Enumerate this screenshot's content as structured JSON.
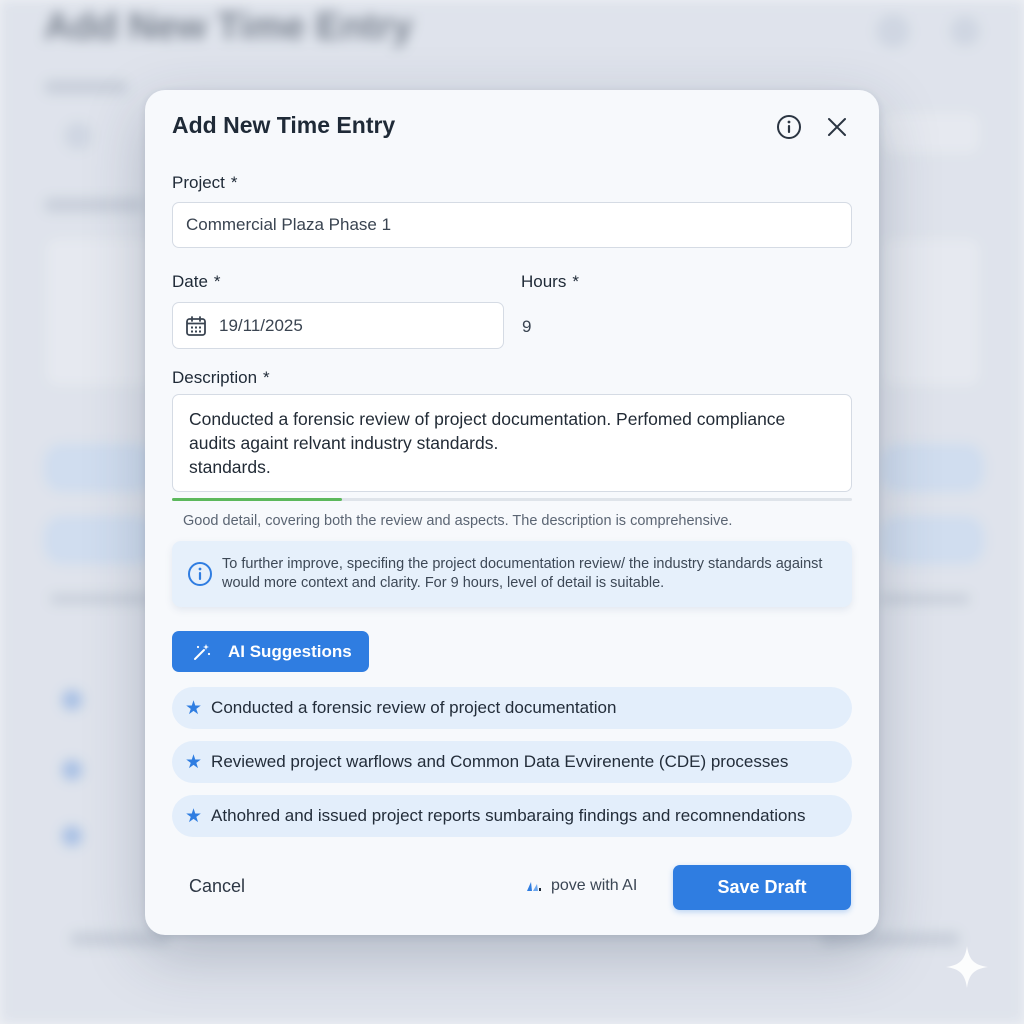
{
  "background": {
    "title": "Add New Time Entry"
  },
  "modal": {
    "title": "Add New Time Entry",
    "info_icon": "info-circle-icon",
    "close_icon": "close-icon"
  },
  "form": {
    "project": {
      "label": "Project",
      "required_mark": "*",
      "value": "Commercial Plaza Phase 1"
    },
    "date": {
      "label": "Date",
      "required_mark": "*",
      "value": "19/11/2025",
      "icon": "calendar-icon"
    },
    "hours": {
      "label": "Hours",
      "required_mark": "*",
      "value": "9"
    },
    "description": {
      "label": "Description",
      "required_mark": "*",
      "value": "Conducted a forensic review of project documentation. Perfomed compliance\naudits againt relvant industry standards.\nstandards."
    },
    "quality_progress": 0.25,
    "feedback": "Good detail, covering both the review and aspects. The description is comprehensive.",
    "tip": "To further improve, specifing the project documentation review/ the industry standards against would more context and clarity. For 9 hours, level of detail is suitable."
  },
  "ai": {
    "button_label": "AI Suggestions",
    "button_icon": "magic-wand-icon",
    "suggestions": [
      "Conducted a forensic review of project documentation",
      "Reviewed project warflows and Common Data Evvirenente (CDE) processes",
      "Athohred and issued project reports sumbaraing findings and recomnendations"
    ]
  },
  "footer": {
    "cancel_label": "Cancel",
    "improve_label": "pove with AI",
    "save_label": "Save Draft"
  },
  "colors": {
    "accent": "#2f7de1",
    "progress": "#5cb85c",
    "suggestion_bg": "#e3eefb",
    "tip_bg": "#e6f0fb"
  }
}
